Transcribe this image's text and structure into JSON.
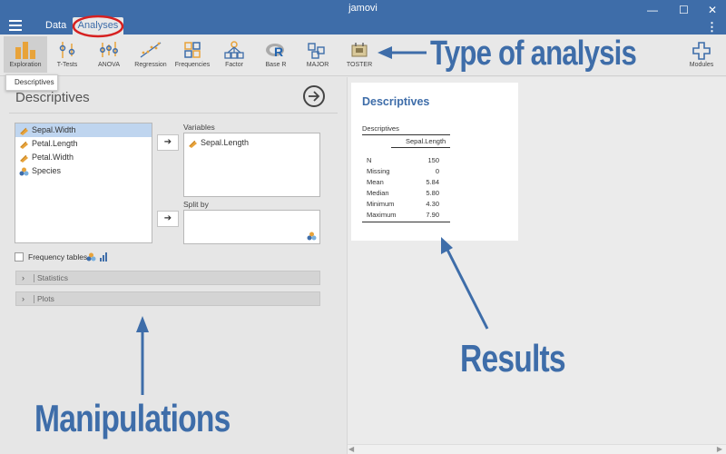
{
  "window": {
    "title": "jamovi",
    "minimize": "—",
    "maximize": "☐",
    "close": "✕",
    "kebab": "⋮"
  },
  "tabs": {
    "data": "Data",
    "analyses": "Analyses"
  },
  "ribbon": {
    "items": [
      {
        "label": "Exploration",
        "icon": "exploration-icon"
      },
      {
        "label": "T-Tests",
        "icon": "ttests-icon"
      },
      {
        "label": "ANOVA",
        "icon": "anova-icon"
      },
      {
        "label": "Regression",
        "icon": "regression-icon"
      },
      {
        "label": "Frequencies",
        "icon": "frequencies-icon"
      },
      {
        "label": "Factor",
        "icon": "factor-icon"
      },
      {
        "label": "Base R",
        "icon": "base-r-icon"
      },
      {
        "label": "MAJOR",
        "icon": "major-icon"
      },
      {
        "label": "TOSTER",
        "icon": "toster-icon"
      },
      {
        "label": "Modules",
        "icon": "modules-icon"
      }
    ]
  },
  "dropdown": {
    "item": "Descriptives"
  },
  "panel": {
    "title": "Descriptives",
    "variables": [
      {
        "name": "Sepal.Width",
        "type": "continuous"
      },
      {
        "name": "Petal.Length",
        "type": "continuous"
      },
      {
        "name": "Petal.Width",
        "type": "continuous"
      },
      {
        "name": "Species",
        "type": "nominal"
      }
    ],
    "move_label": "➔",
    "variables_label": "Variables",
    "variables_assigned": [
      "Sepal.Length"
    ],
    "split_by_label": "Split by",
    "frequency_tables_label": "Frequency tables",
    "sections": [
      "Statistics",
      "Plots"
    ]
  },
  "results": {
    "title": "Descriptives",
    "table_title": "Descriptives",
    "column": "Sepal.Length",
    "rows": [
      {
        "label": "N",
        "value": "150"
      },
      {
        "label": "Missing",
        "value": "0"
      },
      {
        "label": "Mean",
        "value": "5.84"
      },
      {
        "label": "Median",
        "value": "5.80"
      },
      {
        "label": "Minimum",
        "value": "4.30"
      },
      {
        "label": "Maximum",
        "value": "7.90"
      }
    ]
  },
  "annotations": {
    "type_of_analysis": "Type of analysis",
    "manipulations": "Manipulations",
    "results": "Results"
  },
  "colors": {
    "brand": "#3e6da9",
    "highlight_circle": "#d62020",
    "selected_row": "#bfd5ef"
  }
}
